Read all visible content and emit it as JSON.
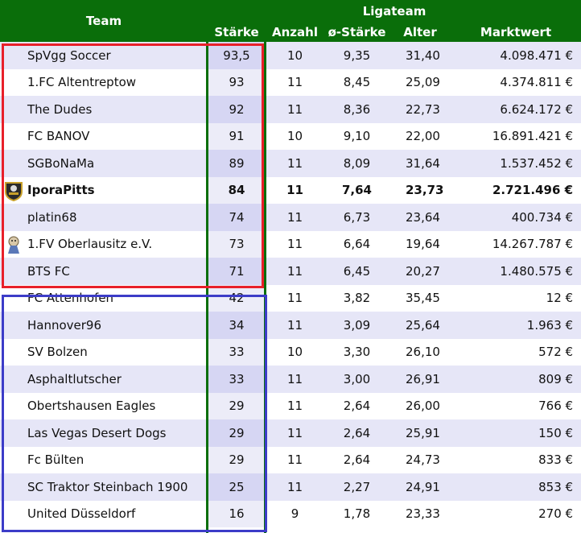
{
  "header": {
    "team": "Team",
    "ligateam": "Ligateam",
    "columns": [
      "Stärke",
      "Anzahl",
      "ø-Stärke",
      "Alter",
      "Marktwert"
    ]
  },
  "rows": [
    {
      "team": "SpVgg Soccer",
      "staerke": "93,5",
      "anzahl": "10",
      "avg": "9,35",
      "alter": "31,40",
      "mw": "4.098.471 €"
    },
    {
      "team": "1.FC Altentreptow",
      "staerke": "93",
      "anzahl": "11",
      "avg": "8,45",
      "alter": "25,09",
      "mw": "4.374.811 €"
    },
    {
      "team": "The Dudes",
      "staerke": "92",
      "anzahl": "11",
      "avg": "8,36",
      "alter": "22,73",
      "mw": "6.624.172 €"
    },
    {
      "team": "FC BANOV",
      "staerke": "91",
      "anzahl": "10",
      "avg": "9,10",
      "alter": "22,00",
      "mw": "16.891.421 €"
    },
    {
      "team": "SGBoNaMa",
      "staerke": "89",
      "anzahl": "11",
      "avg": "8,09",
      "alter": "31,64",
      "mw": "1.537.452 €"
    },
    {
      "team": "IporaPitts",
      "staerke": "84",
      "anzahl": "11",
      "avg": "7,64",
      "alter": "23,73",
      "mw": "2.721.496 €",
      "bold": true,
      "logo": "shield-crest-icon"
    },
    {
      "team": "platin68",
      "staerke": "74",
      "anzahl": "11",
      "avg": "6,73",
      "alter": "23,64",
      "mw": "400.734 €"
    },
    {
      "team": "1.FV Oberlausitz e.V.",
      "staerke": "73",
      "anzahl": "11",
      "avg": "6,64",
      "alter": "19,64",
      "mw": "14.267.787 €",
      "logo": "mascot-icon"
    },
    {
      "team": "BTS FC",
      "staerke": "71",
      "anzahl": "11",
      "avg": "6,45",
      "alter": "20,27",
      "mw": "1.480.575 €"
    },
    {
      "team": "FC Attenhofen",
      "staerke": "42",
      "anzahl": "11",
      "avg": "3,82",
      "alter": "35,45",
      "mw": "12 €"
    },
    {
      "team": "Hannover96",
      "staerke": "34",
      "anzahl": "11",
      "avg": "3,09",
      "alter": "25,64",
      "mw": "1.963 €"
    },
    {
      "team": "SV Bolzen",
      "staerke": "33",
      "anzahl": "10",
      "avg": "3,30",
      "alter": "26,10",
      "mw": "572 €"
    },
    {
      "team": "Asphaltlutscher",
      "staerke": "33",
      "anzahl": "11",
      "avg": "3,00",
      "alter": "26,91",
      "mw": "809 €"
    },
    {
      "team": "Obertshausen Eagles",
      "staerke": "29",
      "anzahl": "11",
      "avg": "2,64",
      "alter": "26,00",
      "mw": "766 €"
    },
    {
      "team": "Las Vegas Desert Dogs",
      "staerke": "29",
      "anzahl": "11",
      "avg": "2,64",
      "alter": "25,91",
      "mw": "150 €"
    },
    {
      "team": "Fc Bülten",
      "staerke": "29",
      "anzahl": "11",
      "avg": "2,64",
      "alter": "24,73",
      "mw": "833 €"
    },
    {
      "team": "SC Traktor Steinbach 1900",
      "staerke": "25",
      "anzahl": "11",
      "avg": "2,27",
      "alter": "24,91",
      "mw": "853 €"
    },
    {
      "team": "United Düsseldorf",
      "staerke": "16",
      "anzahl": "9",
      "avg": "1,78",
      "alter": "23,33",
      "mw": "270 €"
    }
  ],
  "colors": {
    "header_green": "#0a6e0a",
    "top_box": "#e8202a",
    "bottom_box": "#3c3cc8",
    "row_odd": "#e6e6f7"
  }
}
